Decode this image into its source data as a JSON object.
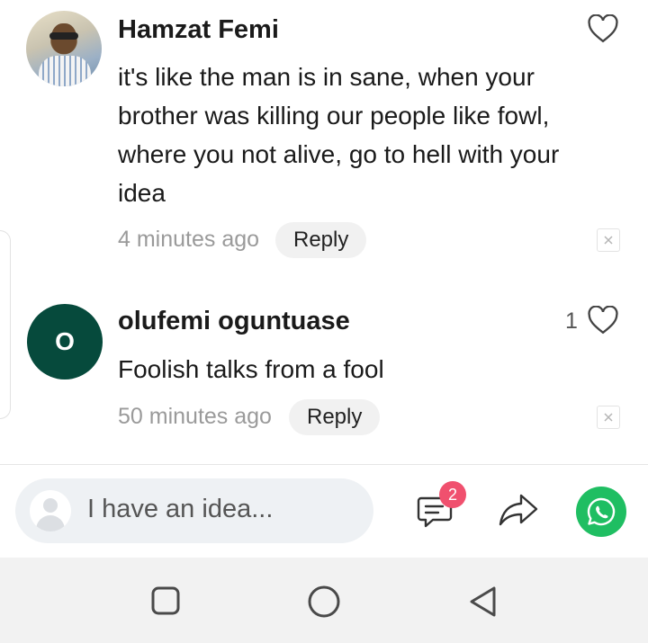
{
  "comments": [
    {
      "username": "Hamzat Femi",
      "text": "it's like the man is in sane, when your brother was killing our people like fowl, where you not alive, go to hell with your idea",
      "time": "4 minutes ago",
      "reply_label": "Reply",
      "likes": ""
    },
    {
      "username": "olufemi oguntuase",
      "avatar_letter": "O",
      "avatar_color": "#064a3c",
      "text": "Foolish talks from a fool",
      "time": "50 minutes ago",
      "reply_label": "Reply",
      "likes": "1"
    }
  ],
  "composer": {
    "placeholder": "I have an idea...",
    "comments_badge": "2"
  },
  "icons": {
    "like": "heart-outline-icon",
    "dismiss": "close-icon",
    "comments": "comment-bubble-icon",
    "share": "share-arrow-icon",
    "whatsapp": "whatsapp-icon",
    "nav": [
      "square-recents-icon",
      "circle-home-icon",
      "triangle-back-icon"
    ]
  },
  "colors": {
    "badge": "#f0506e",
    "whatsapp": "#1fbe62",
    "avatar_letter_bg": "#064a3c"
  }
}
